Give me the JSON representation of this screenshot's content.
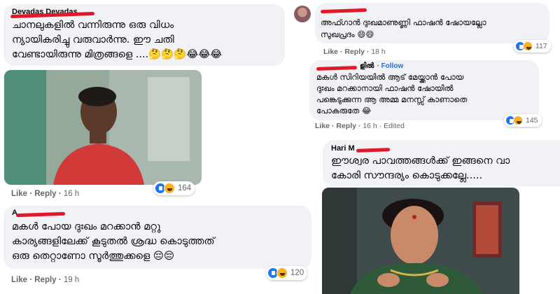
{
  "comments": {
    "c1": {
      "author": "Devadas Devadas",
      "lines": [
        "ചാനലുകളിൽ വന്നിരുന്നു ഒരു വിധം",
        "ന്യായികരിച്ചു വരുവാർന്നു. ഈ ചതി",
        "വേണ്ടായിരുന്നു മിത്രങ്ങളെ ....🤔🤔🤔😂😂😂"
      ]
    },
    "c2": {
      "like": "Like",
      "reply": "Reply",
      "time": "16 h",
      "reactions": "164",
      "reaction_icons": [
        "like-icon",
        "haha-icon"
      ]
    },
    "c3": {
      "author": "A",
      "lines": [
        "മകൾ പോയ ദുഃഖം മറക്കാൻ മറ്റു",
        "കാര്യങ്ങളിലേക്ക് കൂടുതൽ ശ്രദ്ധ കൊടുത്തത്",
        "ഒരു തെറ്റാണോ സൂർത്തുക്കളെ 😔😔"
      ],
      "like": "Like",
      "reply": "Reply",
      "time": "19 h",
      "reactions": "120"
    },
    "c4": {
      "lines": [
        "അഫ്ഗാൻ ദുഃഖമാണുണ്ണി ഫാഷൻ ഷോയല്ലോ",
        "സുഖപ്രദം 😄😄"
      ],
      "like": "Like",
      "reply": "Reply",
      "time": "18 h",
      "reactions": "117"
    },
    "c5": {
      "author_suffix": "ളിൽ",
      "follow": "· Follow",
      "lines": [
        "മകൾ സിറിയയിൽ ആട് മേയ്ക്കാൻ പോയ",
        "ദുഃഖം മറക്കാനായി ഫാഷൻ ഷോയിൽ",
        "പങ്കെടുക്കുന്ന ആ അമ്മ മനസ്സ് കാണാതെ",
        "പോകരുതേ 😂"
      ],
      "like": "Like",
      "reply": "Reply",
      "time": "16 h",
      "edited": "· Edited",
      "reactions": "145"
    },
    "c6": {
      "author": "Hari M",
      "lines": [
        "ഈശ്വര പാവത്തങ്ങൾക്ക് ഇങ്ങനെ വാ",
        "കോരി സൗന്ദര്യം കൊടുക്കല്ലേ....."
      ]
    }
  },
  "colors": {
    "bubble": "#f0f2f5",
    "redaction": "#e0192a",
    "like_blue": "#1877f2",
    "haha_yellow": "#f7b125",
    "meta_gray": "#65676b"
  }
}
